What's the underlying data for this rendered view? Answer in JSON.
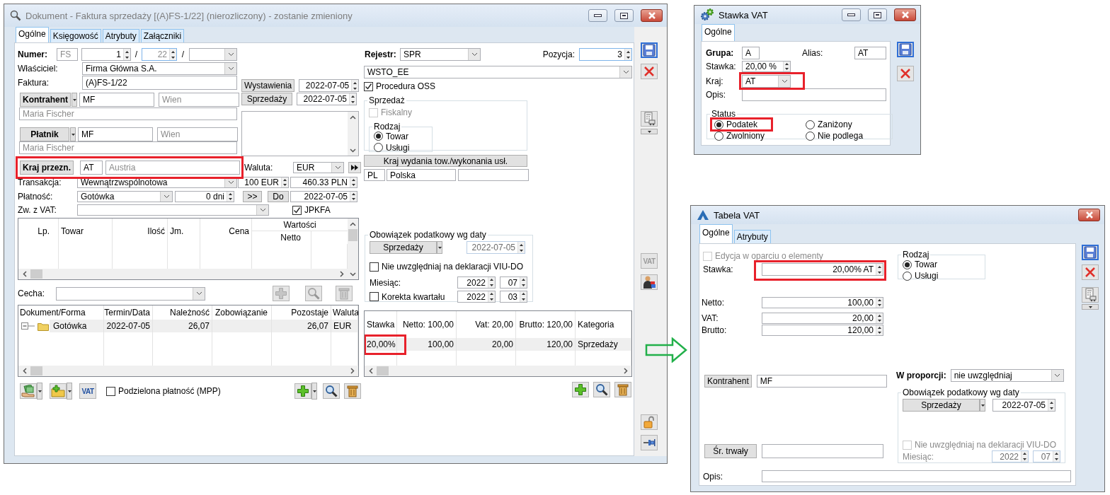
{
  "main_window": {
    "title": "Dokument - Faktura sprzedaży [(A)FS-1/22] (nierozliczony) - zostanie zmieniony",
    "tabs": [
      {
        "label": "Ogólne",
        "selected": true
      },
      {
        "label": "Księgowość",
        "selected": false
      },
      {
        "label": "Atrybuty",
        "selected": false
      },
      {
        "label": "Załączniki",
        "selected": false
      }
    ],
    "number": {
      "label": "Numer:",
      "prefix": "FS",
      "number": "1",
      "slash_1": "/",
      "year": "22",
      "slash_2": "/"
    },
    "owner": {
      "label": "Właściciel:",
      "value": "Firma Główna S.A."
    },
    "invoice": {
      "label": "Faktura:",
      "value": "(A)FS-1/22"
    },
    "dates": [
      {
        "button": "Wystawienia",
        "value": "2022-07-05"
      },
      {
        "button": "Sprzedaży",
        "value": "2022-07-05"
      }
    ],
    "contractor": {
      "button": "Kontrahent",
      "code": "MF",
      "city": "Wien",
      "name": "Maria Fischer"
    },
    "payer": {
      "button": "Płatnik",
      "code": "MF",
      "city": "Wien",
      "name": "Maria Fischer"
    },
    "destination": {
      "button": "Kraj przezn.",
      "code": "AT",
      "country": "Austria",
      "highlighted": true
    },
    "currency": {
      "label": "Waluta:",
      "value": "EUR"
    },
    "transaction": {
      "label": "Transakcja:",
      "value": "Wewnątrzwspólnotowa",
      "rate_base": "100 EUR",
      "rate": "460.33 PLN"
    },
    "payment": {
      "label": "Płatność:",
      "method": "Gotówka",
      "term": "0 dni",
      "shift_button": ">>",
      "due_button": "Do",
      "due_date": "2022-07-05"
    },
    "vat_exemption": {
      "label": "Zw. z VAT:"
    },
    "jpkfa": {
      "label": "JPKFA",
      "checked": true
    },
    "items_table": {
      "columns": [
        "Lp.",
        "Towar",
        "Ilość",
        "Jm.",
        "Cena"
      ],
      "group": "Wartości",
      "subcolumns": [
        "Netto"
      ]
    },
    "feature": {
      "label": "Cecha:",
      "buttons_disabled": true
    },
    "settlements_table": {
      "columns": [
        "Dokument/Forma",
        "Termin/Data",
        "Należność",
        "Zobowiązanie",
        "Pozostaje",
        "Waluta"
      ],
      "rows": [
        {
          "form": "Gotówka",
          "date": "2022-07-05",
          "receivable": "26,07",
          "remaining": "26,07",
          "currency": "EUR",
          "expanded": true
        }
      ]
    },
    "vat_button": {
      "label": "VAT"
    },
    "split_payment": {
      "label": "Podzielona płatność (MPP)",
      "checked": false
    },
    "register": {
      "label": "Rejestr:",
      "value": "SPR"
    },
    "position": {
      "label": "Pozycja:",
      "value": "3"
    },
    "register_description": {
      "value": "WSTO_EE"
    },
    "oss": {
      "label": "Procedura OSS",
      "checked": true
    },
    "sale": {
      "title": "Sprzedaż",
      "fiscal": {
        "label": "Fiskalny",
        "checked": false,
        "disabled": true
      },
      "kind_title": "Rodzaj",
      "kinds": [
        {
          "label": "Towar",
          "selected": true
        },
        {
          "label": "Usługi",
          "selected": false
        }
      ]
    },
    "origin_country": {
      "button": "Kraj wydania tow./wykonania usł.",
      "code": "PL",
      "name": "Polska"
    },
    "tax_obligation": {
      "title": "Obowiązek podatkowy wg daty",
      "button": "Sprzedaży",
      "date": {
        "value": "2022-07-05",
        "disabled": true
      },
      "exclude": {
        "label": "Nie uwzględniaj na deklaracji VIU-DO",
        "checked": false
      },
      "month_label": "Miesiąc:",
      "month_year": "2022",
      "month": "07",
      "correction": {
        "label": "Korekta kwartału",
        "checked": false
      },
      "correction_year": "2022",
      "correction_quarter": "03"
    },
    "vat_table": {
      "columns": [
        "Stawka",
        "Netto: 100,00",
        "Vat: 20,00",
        "Brutto: 120,00",
        "Kategoria"
      ],
      "rows": [
        {
          "rate": "20,00%",
          "net": "100,00",
          "vat": "20,00",
          "gross": "120,00",
          "category": "Sprzedaży",
          "highlighted": true
        }
      ]
    },
    "toolbar": {
      "vat_label": "VAT",
      "vat_disabled": true
    }
  },
  "vat_rate_window": {
    "title": "Stawka VAT",
    "tabs": [
      {
        "label": "Ogólne",
        "selected": true
      }
    ],
    "group": {
      "label": "Grupa:",
      "value": "A"
    },
    "alias": {
      "label": "Alias:",
      "value": "AT"
    },
    "rate": {
      "label": "Stawka:",
      "value": "20,00 %"
    },
    "country": {
      "label": "Kraj:",
      "value": "AT",
      "highlighted": true
    },
    "description": {
      "label": "Opis:"
    },
    "status": {
      "title": "Status",
      "options": [
        {
          "label": "Podatek",
          "selected": true,
          "highlighted": true
        },
        {
          "label": "Zaniżony",
          "selected": false,
          "highlighted": false
        },
        {
          "label": "Zwolniony",
          "selected": false,
          "highlighted": false
        },
        {
          "label": "Nie podlega",
          "selected": false,
          "highlighted": false
        }
      ]
    }
  },
  "vat_table_window": {
    "title": "Tabela VAT",
    "tabs": [
      {
        "label": "Ogólne",
        "selected": true
      },
      {
        "label": "Atrybuty",
        "selected": false
      }
    ],
    "element_edit": {
      "label": "Edycja w oparciu o elementy",
      "checked": false,
      "disabled": true
    },
    "rate": {
      "label": "Stawka:",
      "value": "20,00% AT",
      "highlighted": true
    },
    "kind": {
      "title": "Rodzaj",
      "options": [
        {
          "label": "Towar",
          "selected": true
        },
        {
          "label": "Usługi",
          "selected": false
        }
      ]
    },
    "amounts": [
      {
        "label": "Netto:",
        "value": "100,00"
      },
      {
        "label": "VAT:",
        "value": "20,00"
      },
      {
        "label": "Brutto:",
        "value": "120,00"
      }
    ],
    "contractor": {
      "button": "Kontrahent",
      "value": "MF"
    },
    "proportion": {
      "label": "W proporcji:",
      "value": "nie uwzględniaj"
    },
    "tax_obligation": {
      "title": "Obowiązek podatkowy wg daty",
      "button": "Sprzedaży",
      "date": {
        "value": "2022-07-05",
        "disabled": false
      },
      "exclude": {
        "label": "Nie uwzględniaj na deklaracji VIU-DO",
        "checked": false,
        "disabled": true
      },
      "month": {
        "label": "Miesiąc:",
        "year": "2022",
        "month": "07",
        "disabled": true
      }
    },
    "fixed_asset": {
      "button": "Śr. trwały"
    },
    "description": {
      "label": "Opis:"
    }
  }
}
